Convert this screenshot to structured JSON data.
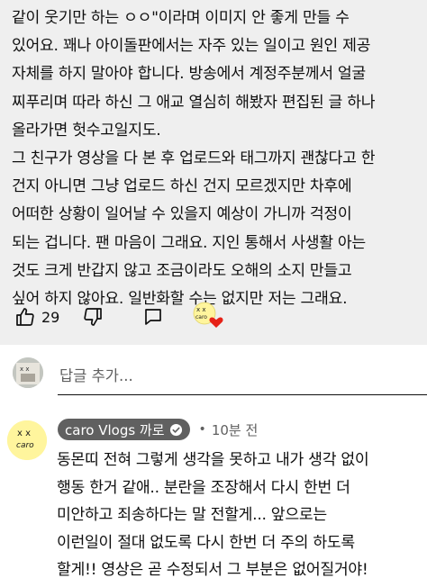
{
  "comment": {
    "text": "같이 웃기만 하는 ㅇㅇ\"이라며 이미지 안 좋게 만들 수\n있어요. 꽤나 아이돌판에서는 자주 있는 일이고 원인 제공\n자체를 하지 말아야 합니다. 방송에서 계정주분께서 얼굴\n찌푸리며 따라 하신 그 애교 열심히 해봤자 편집된 글 하나\n올라가면 헛수고일지도.\n그 친구가 영상을 다 본 후 업로드와 태그까지 괜찮다고 한\n건지 아니면 그냥 업로드 하신 건지 모르겠지만 차후에\n어떠한 상황이 일어날 수 있을지 예상이 가니까 걱정이\n되는 겁니다. 팬 마음이 그래요. 지인 통해서 사생활 아는\n것도 크게 반갑지 않고 조금이라도 오해의 소지 만들고\n싶어 하지 않아요. 일반화할 수는 없지만 저는 그래요.",
    "like_count": "29",
    "icons": {
      "like": "thumb-up-icon",
      "dislike": "thumb-down-icon",
      "reply": "reply-icon",
      "creator_heart": "creator-heart-icon"
    },
    "heart_color": "#e62117"
  },
  "add_reply": {
    "placeholder": "답글 추가..."
  },
  "reply": {
    "author": "caro Vlogs 까로",
    "separator": "•",
    "time": "10분 전",
    "text": "동몬띠 전혀 그렇게 생각을 못하고 내가 생각 없이\n행동 한거 같애.. 분란을 조장해서 다시 한번 더\n미안하고 죄송하다는 말 전할게... 앞으로는\n이런일이 절대 없도록 다시 한번 더 주의 하도록\n할게!! 영상은 곧 수정되서 그 부분은 없어질거야!",
    "avatar_text": "caro",
    "verified_icon": "verified-check-icon"
  }
}
